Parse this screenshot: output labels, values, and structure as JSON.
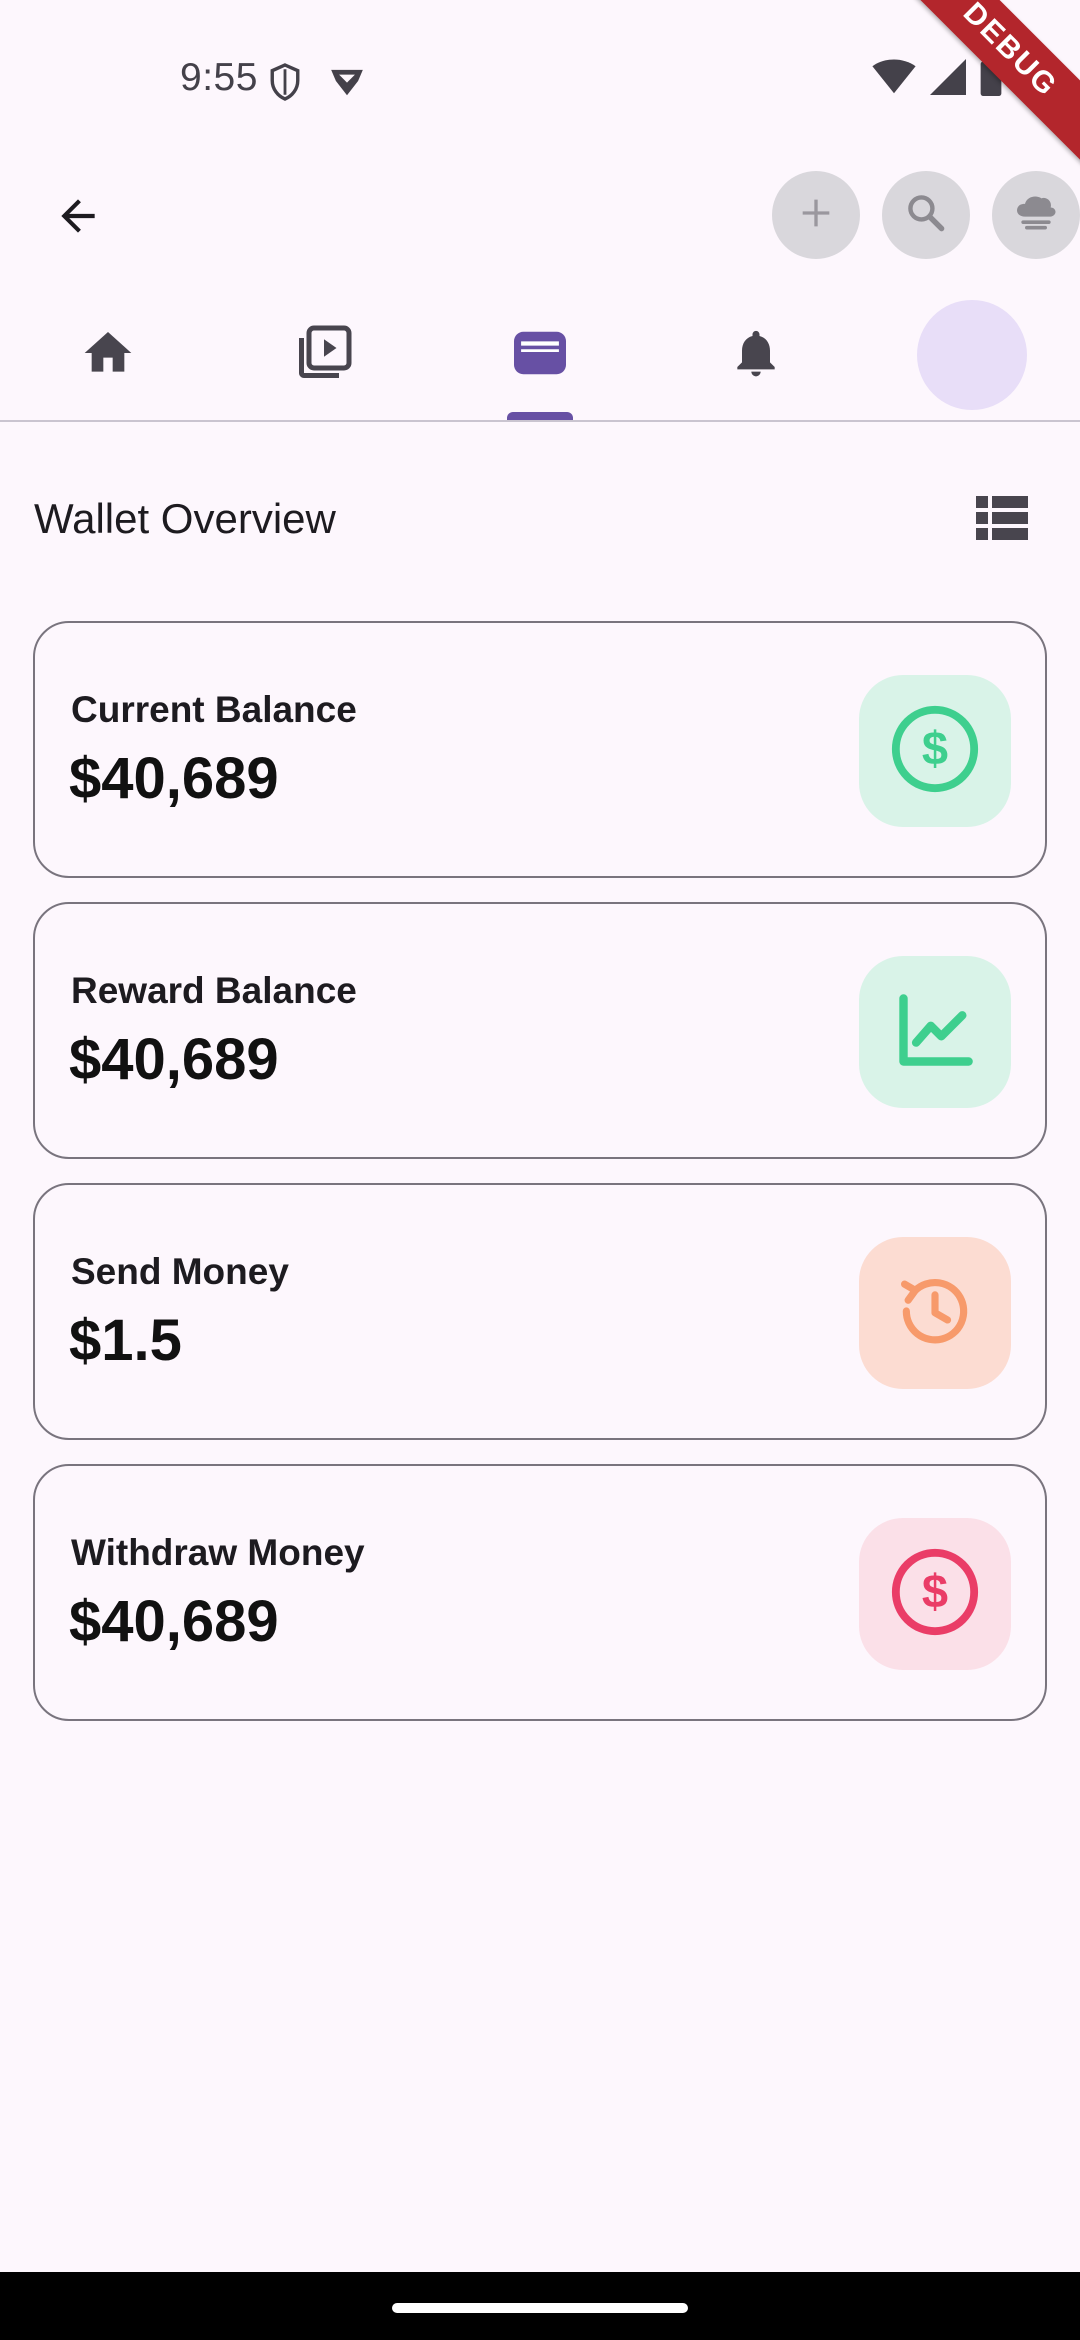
{
  "status_bar": {
    "time": "9:55"
  },
  "debug_banner": "DEBUG",
  "app_bar": {
    "back_icon": "arrow-back-icon",
    "actions": [
      "add-icon",
      "search-icon",
      "cloud-icon"
    ]
  },
  "tabs": [
    {
      "icon": "home-icon",
      "selected": false
    },
    {
      "icon": "video-library-icon",
      "selected": false
    },
    {
      "icon": "wallet-icon",
      "selected": true
    },
    {
      "icon": "notifications-icon",
      "selected": false
    },
    {
      "icon": "avatar",
      "selected": false
    }
  ],
  "section": {
    "title": "Wallet Overview"
  },
  "cards": [
    {
      "label": "Current Balance",
      "value": "$40,689",
      "icon": "dollar-circle-icon",
      "icon_color": "#3ecf8e",
      "bg_color": "#d9f3e8"
    },
    {
      "label": "Reward Balance",
      "value": "$40,689",
      "icon": "trending-chart-icon",
      "icon_color": "#3ecf8e",
      "bg_color": "#d9f3e8"
    },
    {
      "label": "Send Money",
      "value": "$1.5",
      "icon": "history-icon",
      "icon_color": "#f79a6b",
      "bg_color": "#fcdcd2"
    },
    {
      "label": "Withdraw Money",
      "value": "$40,689",
      "icon": "dollar-circle-icon",
      "icon_color": "#ea3d67",
      "bg_color": "#fbe0e8"
    }
  ],
  "colors": {
    "accent": "#6750a4",
    "background": "#fdf7fd"
  }
}
